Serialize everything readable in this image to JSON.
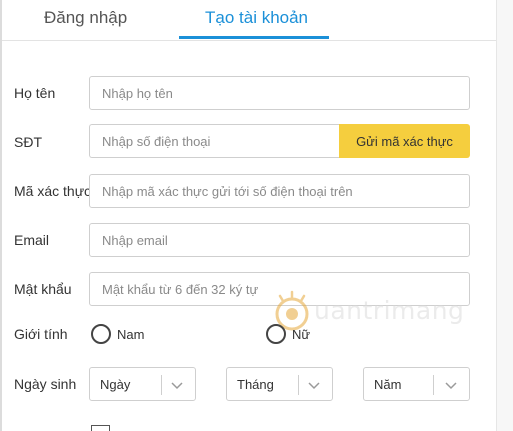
{
  "tabs": {
    "login": "Đăng nhập",
    "register": "Tạo tài khoản"
  },
  "form": {
    "fullname": {
      "label": "Họ tên",
      "placeholder": "Nhập họ tên"
    },
    "phone": {
      "label": "SĐT",
      "placeholder": "Nhập số điện thoại",
      "button": "Gửi mã xác thực"
    },
    "otp": {
      "label": "Mã xác thực",
      "placeholder": "Nhập mã xác thực gửi tới số điện thoại trên"
    },
    "email": {
      "label": "Email",
      "placeholder": "Nhập email"
    },
    "password": {
      "label": "Mật khẩu",
      "placeholder": "Mật khẩu từ 6 đến 32 ký tự"
    },
    "gender": {
      "label": "Giới tính",
      "options": [
        "Nam",
        "Nữ"
      ]
    },
    "birthday": {
      "label": "Ngày sinh",
      "day": "Ngày",
      "month": "Tháng",
      "year": "Năm"
    }
  },
  "watermark": {
    "text": "uantrimang"
  },
  "colors": {
    "accent": "#1b90d8",
    "button": "#f5ce3e",
    "border": "#cfcfcf"
  },
  "icons": {
    "select_arrow": "chevron-down-icon",
    "watermark_logo": "quantrimang-logo-icon"
  }
}
